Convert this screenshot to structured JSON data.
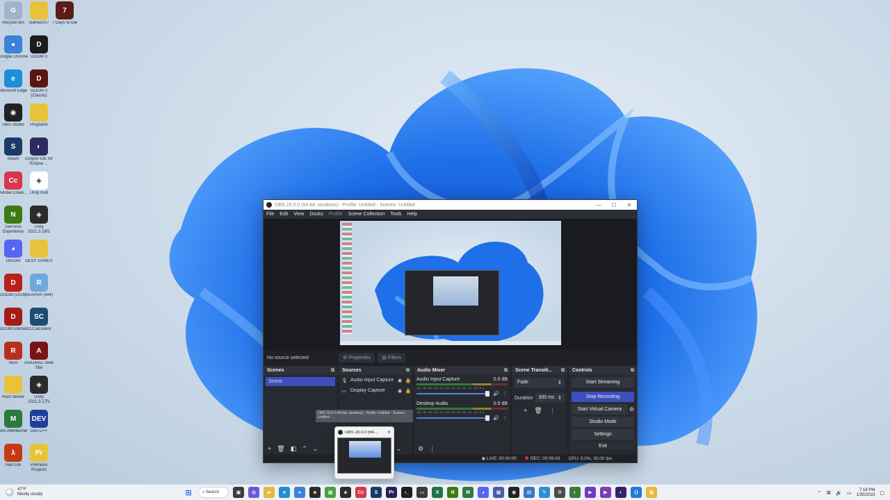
{
  "desktop": {
    "icons": [
      {
        "label": "Recycle Bin",
        "color": "#9fb4c8",
        "glyph": "♻"
      },
      {
        "label": "GameOS7",
        "color": "#e8c33a",
        "glyph": ""
      },
      {
        "label": "7 Days to Die",
        "color": "#5b1b17",
        "glyph": "7"
      },
      {
        "label": "Google Chrome",
        "color": "#3b82d8",
        "glyph": "●"
      },
      {
        "label": "DOOM 3",
        "color": "#1c1c1c",
        "glyph": "D"
      },
      {
        "label": "Microsoft Edge",
        "color": "#1c8fd6",
        "glyph": "e"
      },
      {
        "label": "DOOM 3 (Classic)",
        "color": "#5a1712",
        "glyph": "D"
      },
      {
        "label": "OBS Studio",
        "color": "#222222",
        "glyph": "◉"
      },
      {
        "label": "Programs",
        "color": "#e8c33a",
        "glyph": ""
      },
      {
        "label": "Steam",
        "color": "#1b3a66",
        "glyph": "S"
      },
      {
        "label": "Eclipse IDE for Eclipse ...",
        "color": "#2c2a60",
        "glyph": "◐"
      },
      {
        "label": "Adobe Creati...",
        "color": "#d8364b",
        "glyph": "Cc"
      },
      {
        "label": "Unity Hub",
        "color": "#ffffff",
        "glyph": "◈"
      },
      {
        "label": "GeForce Experience",
        "color": "#3d7a12",
        "glyph": "N"
      },
      {
        "label": "Unity 2021.3.16f1",
        "color": "#2b2b2b",
        "glyph": "◈"
      },
      {
        "label": "Discord",
        "color": "#5865f2",
        "glyph": "◕"
      },
      {
        "label": "DESY GAMES",
        "color": "#e8c33a",
        "glyph": ""
      },
      {
        "label": "DOOM (2016)",
        "color": "#b8221b",
        "glyph": "D"
      },
      {
        "label": "REAPER (x64)",
        "color": "#6fa8dc",
        "glyph": "R"
      },
      {
        "label": "DOOM Eternal",
        "color": "#a31c16",
        "glyph": "D"
      },
      {
        "label": "SCCalculator",
        "color": "#1d4d73",
        "glyph": "SC"
      },
      {
        "label": "Rust",
        "color": "#b7301f",
        "glyph": "R"
      },
      {
        "label": "ASIO4ALL Web Site",
        "color": "#7a1414",
        "glyph": "A"
      },
      {
        "label": "Rust Server",
        "color": "#e8c33a",
        "glyph": ""
      },
      {
        "label": "Unity 2021.3.17f1",
        "color": "#2b2b2b",
        "glyph": "◈"
      },
      {
        "label": "MSI Afterburner",
        "color": "#2c7a3d",
        "glyph": "M"
      },
      {
        "label": "Dev-C++",
        "color": "#1f3f9b",
        "glyph": "DEV"
      },
      {
        "label": "Half-Life",
        "color": "#c23b14",
        "glyph": "λ"
      },
      {
        "label": "Premiere Projects",
        "color": "#e8c33a",
        "glyph": "Pr"
      }
    ]
  },
  "obs": {
    "window_title": "OBS 29.0.0 (64-bit, windows) - Profile: Untitled - Scenes: Untitled",
    "controls": {
      "minimize": "—",
      "maximize": "☐",
      "close": "✕"
    },
    "menu": [
      "File",
      "Edit",
      "View",
      "Docks",
      "Profile",
      "Scene Collection",
      "Tools",
      "Help"
    ],
    "source_bar": {
      "no_source": "No source selected",
      "properties": "Properties",
      "filters": "Filters"
    },
    "scenes": {
      "title": "Scenes",
      "items": [
        "Scene"
      ]
    },
    "sources": {
      "title": "Sources",
      "items": [
        {
          "icon": "microphone-icon",
          "name": "Audio Input Capture"
        },
        {
          "icon": "monitor-icon",
          "name": "Display Capture"
        }
      ]
    },
    "mixer": {
      "title": "Audio Mixer",
      "channels": [
        {
          "name": "Audio Input Capture",
          "level": "0.0 dB"
        },
        {
          "name": "Desktop Audio",
          "level": "0.0 dB"
        }
      ],
      "ticks": "-60 -55 -50 -45 -40 -35 -30 -25 -20 -15 -10 -5 0"
    },
    "transitions": {
      "title": "Scene Transiti...",
      "type": "Fade",
      "duration_label": "Duration",
      "duration_value": "300 ms"
    },
    "controls_dock": {
      "title": "Controls",
      "buttons": [
        "Start Streaming",
        "Stop Recording",
        "Start Virtual Camera",
        "Studio Mode",
        "Settings",
        "Exit"
      ]
    },
    "status": {
      "live": "LIVE: 00:00:00",
      "rec": "REC: 00:09:43",
      "cpu": "CPU: 0.0%, 30.00 fps"
    }
  },
  "taskbar_preview": {
    "title": "OBS 29.0.0 (64-...",
    "ghost_text": "OBS 29.0.0 (64-bit, windows) - Profile: Untitled - Scenes: Untitled"
  },
  "taskbar": {
    "weather_temp": "47°F",
    "weather_desc": "Mostly cloudy",
    "search": "Search",
    "time": "7:18 PM",
    "date": "1/30/2023"
  }
}
